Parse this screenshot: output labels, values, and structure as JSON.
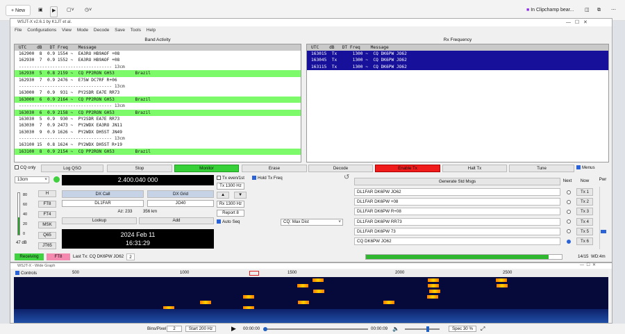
{
  "taskbar": {
    "new_label": "New",
    "clipchamp_label": "In Clipchamp bear..."
  },
  "window": {
    "title": "WSJT-X   v2.6.1   by K1JT et al.",
    "menu": [
      "File",
      "Configurations",
      "View",
      "Mode",
      "Decode",
      "Save",
      "Tools",
      "Help"
    ]
  },
  "band_activity": {
    "header": "Band Activity",
    "columns": "UTC    dB   DT Freq    Message",
    "rows": [
      {
        "text": "162900  8  0.9 1554 ~  EA3RO HB9AOF +08",
        "kind": "normal"
      },
      {
        "text": "162930  7  0.9 1552 ~  EA3RO HB9AOF +08",
        "kind": "normal"
      },
      {
        "text": "------------------------------------ 13cm",
        "kind": "sep"
      },
      {
        "text": "162930  5  0.8 2159 ~  CQ PP2RON GH53        Brazil",
        "kind": "cq"
      },
      {
        "text": "162930  7  0.9 2476 ~  E75W DC7RF R+06",
        "kind": "normal"
      },
      {
        "text": "------------------------------------ 13cm",
        "kind": "sep"
      },
      {
        "text": "163000  7  0.9  931 ~  PY2SDR EA7E RR73",
        "kind": "normal"
      },
      {
        "text": "163000  6  0.9 2164 ~  CQ PP2RON GH53        Brazil",
        "kind": "cq"
      },
      {
        "text": "------------------------------------ 13cm",
        "kind": "sep"
      },
      {
        "text": "163030  6  0.9 2158 ~  CQ PP2RON GH53        Brazil",
        "kind": "cq"
      },
      {
        "text": "163030  5  0.9  930 ~  PY2SDR EA7E RR73",
        "kind": "normal"
      },
      {
        "text": "163030  7  0.9 2473 ~  PY2WDX EA3RO JN11",
        "kind": "normal"
      },
      {
        "text": "163030  9  0.9 1626 ~  PY2WDX DH5ST JN49",
        "kind": "normal"
      },
      {
        "text": "------------------------------------ 13cm",
        "kind": "sep"
      },
      {
        "text": "163100 15  0.8 1624 ~  PY2WDX DH5ST R+19",
        "kind": "normal"
      },
      {
        "text": "163100  8  0.9 2154 ~  CQ PP2RON GH53        Brazil",
        "kind": "cq"
      }
    ]
  },
  "rx_frequency": {
    "header": "Rx Frequency",
    "columns": "UTC    dB   DT Freq    Message",
    "rows": [
      {
        "text": "163015  Tx      1300 ~  CQ DK6PW JO62"
      },
      {
        "text": "163045  Tx      1300 ~  CQ DK6PW JO62"
      },
      {
        "text": "163115  Tx      1300 ~  CQ DK6PW JO62"
      }
    ]
  },
  "buttons": {
    "cq_only": "CQ only",
    "log_qso": "Log QSO",
    "stop": "Stop",
    "monitor": "Monitor",
    "erase": "Erase",
    "decode": "Decode",
    "enable_tx": "Enable Tx",
    "halt_tx": "Halt Tx",
    "tune": "Tune",
    "menus": "Menus"
  },
  "controls": {
    "band": "13cm",
    "frequency": "2.400.040 000",
    "tx_even": "Tx even/1st",
    "hold_tx": "Hold Tx Freq",
    "tx_hz": "Tx 1300 Hz",
    "rx_hz": "Rx 1300 Hz",
    "report": "Report 8",
    "auto_seq": "Auto Seq",
    "dx_call_label": "DX Call",
    "dx_grid_label": "DX Grid",
    "dx_call": "DL1FAR",
    "dx_grid": "JO40",
    "az": "Az: 233",
    "km": "356 km",
    "lookup": "Lookup",
    "add": "Add",
    "date": "2024 Feb 11",
    "time": "16:31:29",
    "cq_mode": "CQ: Max Dist",
    "level": "47 dB",
    "mode_buttons": [
      "H",
      "FT8",
      "FT4",
      "MSK",
      "Q65",
      "JT65"
    ],
    "meter_ticks": [
      "80",
      "60",
      "40",
      "20",
      "0"
    ]
  },
  "messages": {
    "generate": "Generate Std Msgs",
    "next": "Next",
    "now": "Now",
    "pwr": "Pwr",
    "tx": [
      {
        "msg": "DL1FAR DK6PW JO62",
        "btn": "Tx 1"
      },
      {
        "msg": "DL1FAR DK6PW +08",
        "btn": "Tx 2"
      },
      {
        "msg": "DL1FAR DK6PW R+08",
        "btn": "Tx 3"
      },
      {
        "msg": "DL1FAR DK6PW RR73",
        "btn": "Tx 4"
      },
      {
        "msg": "DL1FAR DK6PW 73",
        "btn": "Tx 5"
      },
      {
        "msg": "CQ DK6PW JO62",
        "btn": "Tx 6"
      }
    ],
    "next_selected": 5
  },
  "status": {
    "receiving": "Receiving",
    "mode": "FT8",
    "last_tx": "Last Tx: CQ DK6PW JO62",
    "count": "2",
    "progress": "14/15",
    "wd": "WD:4m"
  },
  "wide_graph": {
    "title": "WSJT-X - Wide Graph",
    "controls_label": "Controls",
    "scale_labels": [
      "500",
      "1000",
      "1500",
      "2000",
      "2500"
    ],
    "bins_label": "Bins/Pixel",
    "bins_value": "2",
    "start_label": "Start 200 Hz",
    "spec_label": "Spec 30 %",
    "signals": [
      {
        "hz": 930,
        "lane": 5
      },
      {
        "hz": 1300,
        "lane": 3
      },
      {
        "hz": 1300,
        "lane": 5
      },
      {
        "hz": 1552,
        "lane": 1
      },
      {
        "hz": 1554,
        "lane": 4
      },
      {
        "hz": 1624,
        "lane": 0
      },
      {
        "hz": 1626,
        "lane": 2
      },
      {
        "hz": 2158,
        "lane": 0
      },
      {
        "hz": 2159,
        "lane": 1
      },
      {
        "hz": 2164,
        "lane": 2
      },
      {
        "hz": 2473,
        "lane": 0
      },
      {
        "hz": 2476,
        "lane": 1
      },
      {
        "hz": 2154,
        "lane": 3
      },
      {
        "hz": 1950,
        "lane": 4
      },
      {
        "hz": 1100,
        "lane": 4
      }
    ]
  },
  "player": {
    "time_a": "00:00:00",
    "time_b": "00:00:09"
  },
  "colors": {
    "cq_green": "#7dfa6a",
    "tx_blue": "#16109a",
    "monitor_green": "#38d038",
    "enable_tx_red": "#f01c1c"
  }
}
